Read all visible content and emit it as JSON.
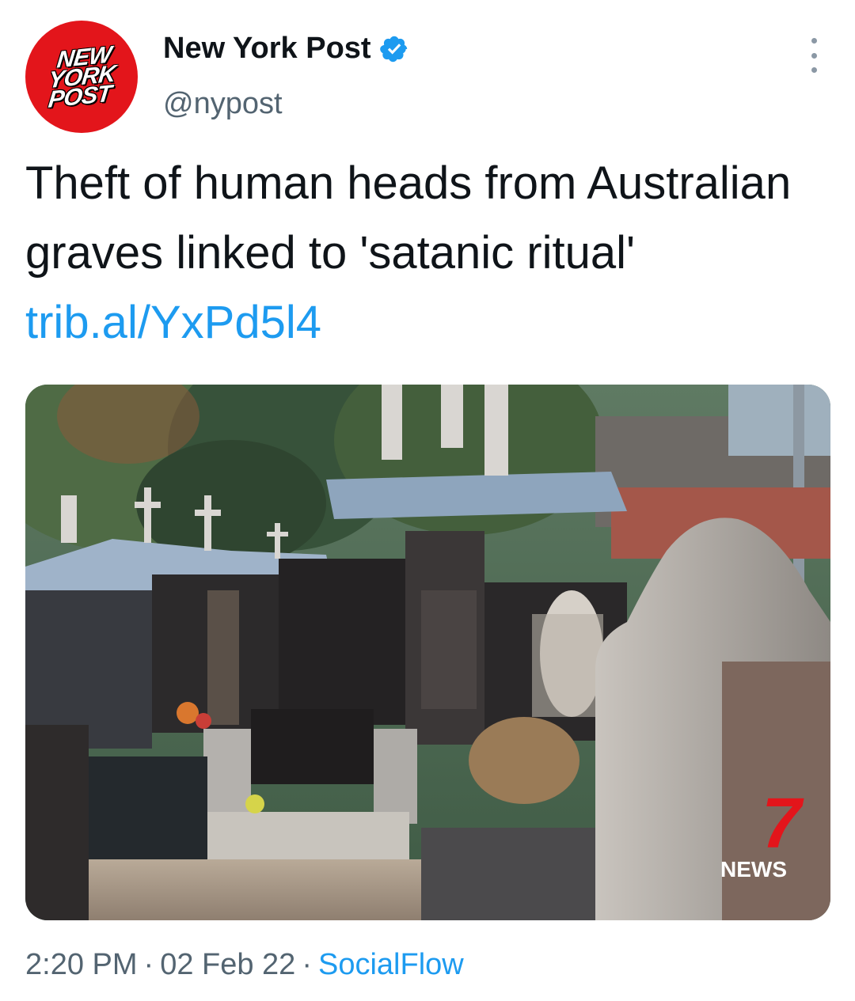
{
  "author": {
    "avatar_logo": [
      "NEW",
      "YORK",
      "POST"
    ],
    "display_name": "New York Post",
    "handle": "@nypost",
    "verified": true
  },
  "tweet": {
    "text": "Theft of human heads from Australian graves linked to 'satanic ritual'",
    "link": "trib.al/YxPd5l4"
  },
  "media": {
    "watermark_number": "7",
    "watermark_text": "NEWS"
  },
  "meta": {
    "time": "2:20 PM",
    "date": "02 Feb 22",
    "separator": "·",
    "source": "SocialFlow"
  },
  "colors": {
    "brand_red": "#e3151b",
    "link_blue": "#1d9bf0",
    "secondary_text": "#536471",
    "verified_blue": "#1d9bf0"
  },
  "icons": [
    "verified-badge-icon",
    "more-options-icon"
  ]
}
